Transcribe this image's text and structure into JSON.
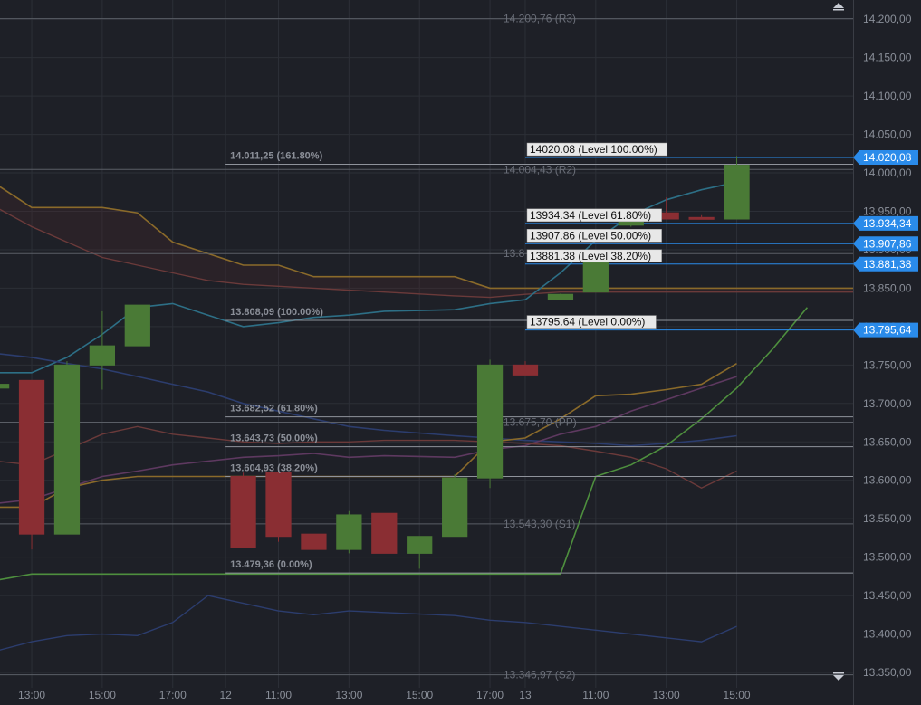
{
  "colors": {
    "background": "#1e2027",
    "grid": "#2c2f37",
    "bull": "#4a7a36",
    "bear": "#8a2e33",
    "tag": "#2a8bea",
    "fib_line": "#2a8bea",
    "pivot_line": "#b8bcc4",
    "kijun": "#8a6a2a",
    "tenkan": "#2d6f86",
    "cloud_a": "#6b3a3a",
    "cloud_b": "#2d4a2d",
    "chikou": "#4e8f3e",
    "slow_ma": "#2c3d6e",
    "magenta_ma": "#5e3960"
  },
  "icons": [
    "scroll-up-icon",
    "scroll-down-icon"
  ],
  "chart_data": {
    "type": "candlestick",
    "y_axis": {
      "range": [
        13330,
        14225
      ],
      "ticks": [
        "14.200,00",
        "14.150,00",
        "14.100,00",
        "14.050,00",
        "14.000,00",
        "13.950,00",
        "13.900,00",
        "13.850,00",
        "13.800,00",
        "13.750,00",
        "13.700,00",
        "13.650,00",
        "13.600,00",
        "13.550,00",
        "13.500,00",
        "13.450,00",
        "13.400,00",
        "13.350,00"
      ],
      "tick_values": [
        14200,
        14150,
        14100,
        14050,
        14000,
        13950,
        13900,
        13850,
        13800,
        13750,
        13700,
        13650,
        13600,
        13550,
        13500,
        13450,
        13400,
        13350
      ]
    },
    "x_axis": {
      "ticks": [
        "13:00",
        "15:00",
        "17:00",
        "12",
        "11:00",
        "13:00",
        "15:00",
        "17:00",
        "13",
        "11:00",
        "13:00",
        "15:00"
      ],
      "tick_index": [
        0,
        2,
        4,
        5.5,
        7,
        9,
        11,
        13,
        14,
        16,
        18,
        20
      ]
    },
    "bar_index_range": [
      -0.9,
      23.3
    ],
    "candles": [
      {
        "i": -1,
        "o": 13740,
        "h": 13745,
        "l": 13672,
        "c": 13672
      },
      {
        "i": -0.5,
        "o": 13720,
        "h": 13728,
        "l": 13712,
        "c": 13725
      },
      {
        "i": 0,
        "o": 13730,
        "h": 13730,
        "l": 13510,
        "c": 13530
      },
      {
        "i": 0.5,
        "o": 13530,
        "h": 13755,
        "l": 13530,
        "c": 13750
      },
      {
        "i": 1,
        "o": 13750,
        "h": 13820,
        "l": 13718,
        "c": 13775
      },
      {
        "i": 1.5,
        "o": 13775,
        "h": 13828,
        "l": 13775,
        "c": 13828
      },
      {
        "i": 3,
        "o": 13605,
        "h": 13610,
        "l": 13512,
        "c": 13512
      },
      {
        "i": 3.5,
        "o": 13610,
        "h": 13610,
        "l": 13520,
        "c": 13527
      },
      {
        "i": 4,
        "o": 13530,
        "h": 13530,
        "l": 13510,
        "c": 13510
      },
      {
        "i": 4.5,
        "o": 13510,
        "h": 13560,
        "l": 13505,
        "c": 13555
      },
      {
        "i": 5,
        "o": 13557,
        "h": 13557,
        "l": 13505,
        "c": 13505
      },
      {
        "i": 5.5,
        "o": 13505,
        "h": 13527,
        "l": 13485,
        "c": 13527
      },
      {
        "i": 6,
        "o": 13527,
        "h": 13608,
        "l": 13527,
        "c": 13603
      },
      {
        "i": 6.5,
        "o": 13603,
        "h": 13757,
        "l": 13590,
        "c": 13750
      },
      {
        "i": 7,
        "o": 13750,
        "h": 13755,
        "l": 13737,
        "c": 13737
      },
      {
        "i": 7.5,
        "o": 13835,
        "h": 13843,
        "l": 13835,
        "c": 13842
      },
      {
        "i": 8,
        "o": 13845,
        "h": 13895,
        "l": 13845,
        "c": 13893
      },
      {
        "i": 8.5,
        "o": 13932,
        "h": 13948,
        "l": 13930,
        "c": 13945
      },
      {
        "i": 9,
        "o": 13948,
        "h": 13968,
        "l": 13940,
        "c": 13940
      },
      {
        "i": 9.5,
        "o": 13942,
        "h": 13945,
        "l": 13940,
        "c": 13940
      },
      {
        "i": 10,
        "o": 13940,
        "h": 14022,
        "l": 13940,
        "c": 14010
      }
    ],
    "fib_retracement": [
      {
        "price": "14020.08",
        "label": "14020.08 (Level 100.00%)",
        "tag": "14.020,08"
      },
      {
        "price": "13934.34",
        "label": "13934.34 (Level 61.80%)",
        "tag": "13.934,34"
      },
      {
        "price": "13907.86",
        "label": "13907.86 (Level 50.00%)",
        "tag": "13.907,86"
      },
      {
        "price": "13881.38",
        "label": "13881.38 (Level 38.20%)",
        "tag": "13.881,38"
      },
      {
        "price": "13795.64",
        "label": "13795.64 (Level 0.00%)",
        "tag": "13.795,64"
      }
    ],
    "previous_fib_labels": [
      "14.011,25 (161.80%)",
      "13.808,09 (100.00%)",
      "13.682,52 (61.80%)",
      "13.643,73 (50.00%)",
      "13.604,93 (38.20%)",
      "13.479,36 (0.00%)"
    ],
    "pivot_labels": [
      "14.200,76 (R3)",
      "14.004,43 (R2)",
      "13.8",
      "13.675,70 (PP)",
      "13.543,30 (S1)",
      "13.346,97 (S2)"
    ]
  }
}
